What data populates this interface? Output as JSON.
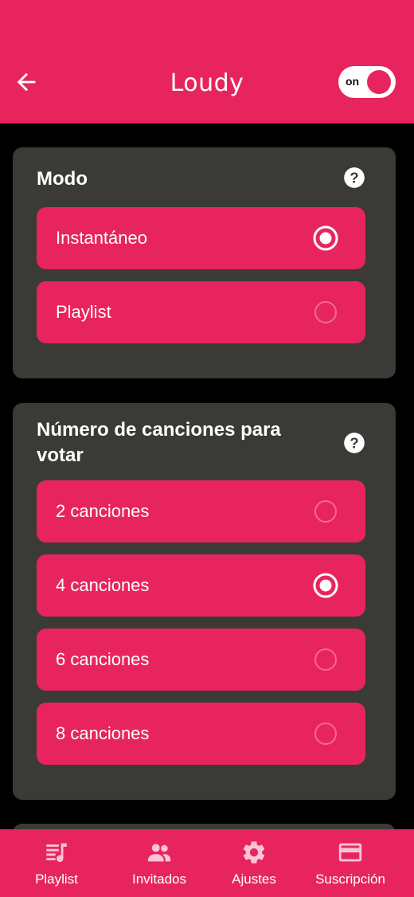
{
  "header": {
    "title": "Loudy",
    "toggle_label": "on",
    "toggle_on": true
  },
  "mode_section": {
    "title": "Modo",
    "options": [
      {
        "label": "Instantáneo",
        "selected": true
      },
      {
        "label": "Playlist",
        "selected": false
      }
    ]
  },
  "songs_section": {
    "title": "Número de canciones para votar",
    "options": [
      {
        "label": "2 canciones",
        "selected": false
      },
      {
        "label": "4 canciones",
        "selected": true
      },
      {
        "label": "6 canciones",
        "selected": false
      },
      {
        "label": "8 canciones",
        "selected": false
      }
    ]
  },
  "bottom_nav": {
    "items": [
      {
        "label": "Playlist",
        "icon": "playlist-icon"
      },
      {
        "label": "Invitados",
        "icon": "people-icon"
      },
      {
        "label": "Ajustes",
        "icon": "gear-icon"
      },
      {
        "label": "Suscripción",
        "icon": "credit-card-icon"
      }
    ]
  },
  "colors": {
    "accent": "#E8245E",
    "card": "#3A3B37",
    "background": "#000000"
  }
}
